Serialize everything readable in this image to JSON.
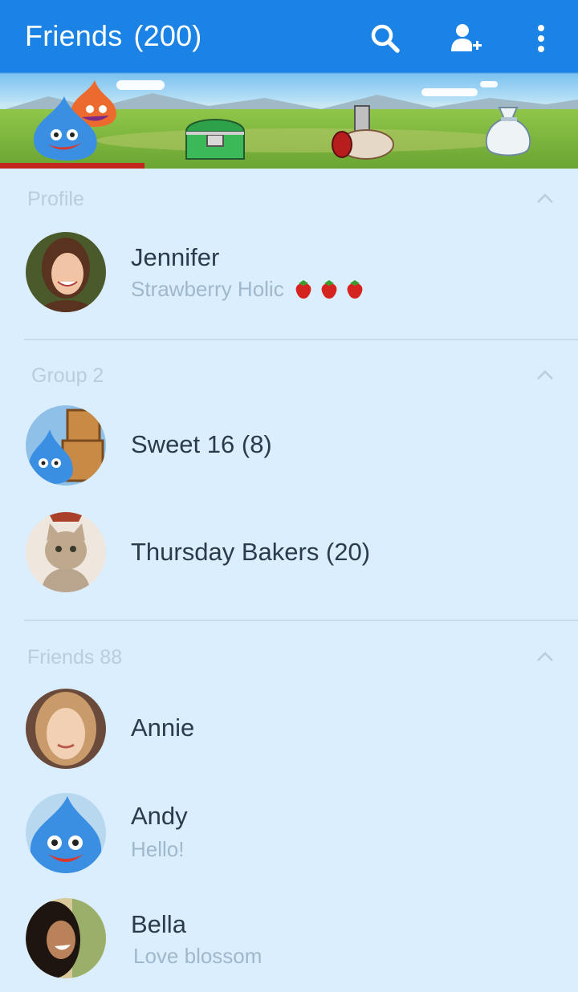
{
  "header": {
    "title": "Friends",
    "count": "(200)",
    "search_icon": "search-icon",
    "add_friend_icon": "add-friend-icon",
    "menu_icon": "more-vertical-icon",
    "colors": {
      "bar": "#1b83e6",
      "progress": "#c3261d"
    },
    "progress_fraction": 0.25
  },
  "sections": {
    "profile": {
      "title": "Profile",
      "rows": [
        {
          "name": "Jennifer",
          "status": "Strawberry Holic",
          "emoji": "strawberry x3"
        }
      ]
    },
    "groups": {
      "title": "Group 2",
      "rows": [
        {
          "name": "Sweet 16 (8)"
        },
        {
          "name": "Thursday Bakers (20)"
        }
      ]
    },
    "friends": {
      "title": "Friends 88",
      "rows": [
        {
          "name": "Annie"
        },
        {
          "name": "Andy",
          "status": "Hello!"
        },
        {
          "name": "Bella",
          "status": "Love blossom"
        }
      ]
    }
  }
}
